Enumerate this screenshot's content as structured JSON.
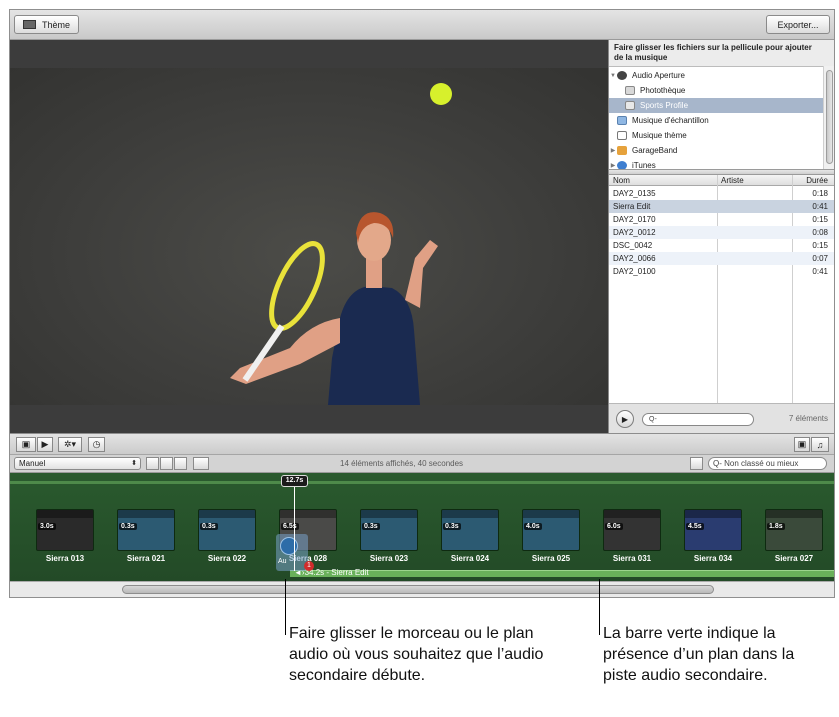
{
  "toolbar": {
    "theme_label": "Thème",
    "export_label": "Exporter..."
  },
  "browser": {
    "hint": "Faire glisser les fichiers sur la pellicule pour ajouter de la musique",
    "sources": [
      {
        "label": "Audio Aperture",
        "icon": "aperture-icon"
      },
      {
        "label": "Photothèque",
        "icon": "library-icon"
      },
      {
        "label": "Sports Profile",
        "icon": "project-icon"
      },
      {
        "label": "Musique d'échantillon",
        "icon": "folder-icon"
      },
      {
        "label": "Musique thème",
        "icon": "music-file-icon"
      },
      {
        "label": "GarageBand",
        "icon": "guitar-icon"
      },
      {
        "label": "iTunes",
        "icon": "itunes-icon"
      }
    ],
    "columns": {
      "name": "Nom",
      "artist": "Artiste",
      "duration": "Durée"
    },
    "tracks": [
      {
        "name": "DAY2_0135",
        "duration": "0:18"
      },
      {
        "name": "Sierra Edit",
        "duration": "0:41"
      },
      {
        "name": "DAY2_0170",
        "duration": "0:15"
      },
      {
        "name": "DAY2_0012",
        "duration": "0:08"
      },
      {
        "name": "DSC_0042",
        "duration": "0:15"
      },
      {
        "name": "DAY2_0066",
        "duration": "0:07"
      },
      {
        "name": "DAY2_0100",
        "duration": "0:41"
      }
    ],
    "search_placeholder": "Q-",
    "item_count": "7 éléments"
  },
  "controls": {
    "sort_mode": "Manuel",
    "status": "14 éléments affichés, 40 secondes",
    "filter_placeholder": "Q- Non classé ou mieux"
  },
  "filmstrip": {
    "playhead_time": "12.7s",
    "clips": [
      {
        "label": "Sierra 013",
        "duration": "3.0s",
        "color": "#2a2a2a"
      },
      {
        "label": "Sierra 021",
        "duration": "0.3s",
        "color": "#2c5a72"
      },
      {
        "label": "Sierra 022",
        "duration": "0.3s",
        "color": "#2c5a72"
      },
      {
        "label": "Sierra 028",
        "duration": "6.5s",
        "color": "#4a4a48"
      },
      {
        "label": "Sierra 023",
        "duration": "0.3s",
        "color": "#2c5a72"
      },
      {
        "label": "Sierra 024",
        "duration": "0.3s",
        "color": "#2c5a72"
      },
      {
        "label": "Sierra 025",
        "duration": "4.0s",
        "color": "#2c5a72"
      },
      {
        "label": "Sierra 031",
        "duration": "6.0s",
        "color": "#333"
      },
      {
        "label": "Sierra 034",
        "duration": "4.5s",
        "color": "#2a3c70"
      },
      {
        "label": "Sierra 027",
        "duration": "1.8s",
        "color": "#3a4a3a"
      }
    ],
    "audio_track_label": "◄›34.2s - Sierra Edit",
    "drag_label": "Au",
    "drag_badge": "1"
  },
  "callouts": {
    "left": "Faire glisser le morceau ou le plan audio où vous souhaitez que l’audio secondaire débute.",
    "right": "La barre verte indique la présence d’un plan dans la piste audio secondaire."
  }
}
